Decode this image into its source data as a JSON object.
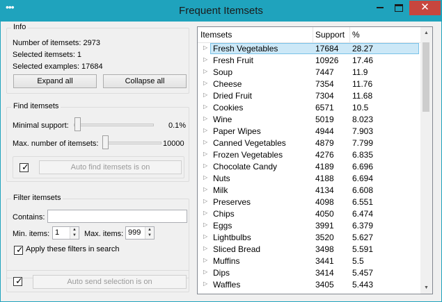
{
  "window": {
    "title": "Frequent Itemsets",
    "sysmenu_icon": "ellipsis-icon",
    "minimize_icon": "minimize-icon",
    "maximize_icon": "maximize-icon",
    "close_icon": "close-icon",
    "close_glyph": "✕",
    "accent": "#1fa3bd",
    "close_color": "#c7463e"
  },
  "info": {
    "title": "Info",
    "num_itemsets": "Number of itemsets: 2973",
    "selected_itemsets": "Selected itemsets: 1",
    "selected_examples": "Selected examples: 17684",
    "expand_label": "Expand all",
    "collapse_label": "Collapse all"
  },
  "find": {
    "title": "Find itemsets",
    "min_support_label": "Minimal support:",
    "min_support_value": "0.1%",
    "min_support_level": 0.01,
    "max_itemsets_label": "Max. number of itemsets:",
    "max_itemsets_value": "10000",
    "max_itemsets_level": 0.0,
    "auto_find_checked": true,
    "auto_find_label": "Auto find itemsets is on"
  },
  "filter": {
    "title": "Filter itemsets",
    "contains_label": "Contains:",
    "contains_value": "",
    "min_items_label": "Min. items:",
    "min_items_value": "1",
    "max_items_label": "Max. items:",
    "max_items_value": "999",
    "apply_checked": true,
    "apply_label": "Apply these filters in search"
  },
  "send": {
    "auto_send_checked": true,
    "auto_send_label": "Auto send selection is on"
  },
  "table": {
    "columns": [
      "Itemsets",
      "Support",
      "%"
    ],
    "rows": [
      {
        "name": "Fresh Vegetables",
        "support": "17684",
        "pct": "28.27",
        "selected": true
      },
      {
        "name": "Fresh Fruit",
        "support": "10926",
        "pct": "17.46"
      },
      {
        "name": "Soup",
        "support": "7447",
        "pct": "11.9"
      },
      {
        "name": "Cheese",
        "support": "7354",
        "pct": "11.76"
      },
      {
        "name": "Dried Fruit",
        "support": "7304",
        "pct": "11.68"
      },
      {
        "name": "Cookies",
        "support": "6571",
        "pct": "10.5"
      },
      {
        "name": "Wine",
        "support": "5019",
        "pct": "8.023"
      },
      {
        "name": "Paper Wipes",
        "support": "4944",
        "pct": "7.903"
      },
      {
        "name": "Canned Vegetables",
        "support": "4879",
        "pct": "7.799"
      },
      {
        "name": "Frozen Vegetables",
        "support": "4276",
        "pct": "6.835"
      },
      {
        "name": "Chocolate Candy",
        "support": "4189",
        "pct": "6.696"
      },
      {
        "name": "Nuts",
        "support": "4188",
        "pct": "6.694"
      },
      {
        "name": "Milk",
        "support": "4134",
        "pct": "6.608"
      },
      {
        "name": "Preserves",
        "support": "4098",
        "pct": "6.551"
      },
      {
        "name": "Chips",
        "support": "4050",
        "pct": "6.474"
      },
      {
        "name": "Eggs",
        "support": "3991",
        "pct": "6.379"
      },
      {
        "name": "Lightbulbs",
        "support": "3520",
        "pct": "5.627"
      },
      {
        "name": "Sliced Bread",
        "support": "3498",
        "pct": "5.591"
      },
      {
        "name": "Muffins",
        "support": "3441",
        "pct": "5.5"
      },
      {
        "name": "Dips",
        "support": "3414",
        "pct": "5.457"
      },
      {
        "name": "Waffles",
        "support": "3405",
        "pct": "5.443"
      }
    ]
  }
}
